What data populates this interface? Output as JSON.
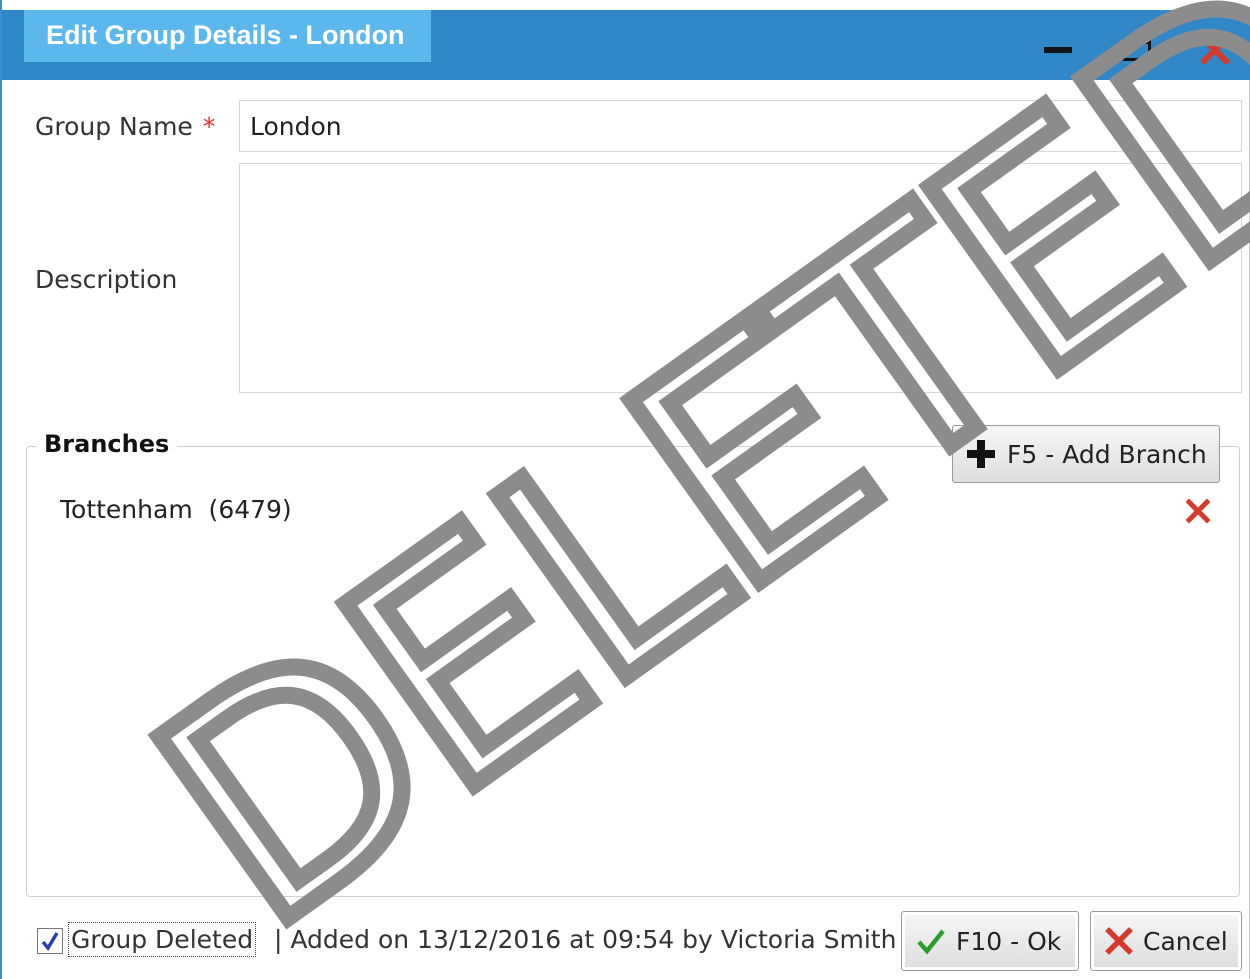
{
  "window": {
    "title": "Edit Group Details - London"
  },
  "form": {
    "group_name_label": "Group Name",
    "required_marker": "*",
    "group_name_value": "London",
    "description_label": "Description",
    "description_value": ""
  },
  "branches": {
    "legend": "Branches",
    "add_button_label": "F5 - Add Branch",
    "items": [
      {
        "label": "Tottenham  (6479)"
      }
    ]
  },
  "watermark": {
    "text": "DELETED"
  },
  "footer": {
    "deleted_checkbox_label": "Group Deleted",
    "deleted_checked": true,
    "status_text": "| Added on 13/12/2016 at 09:54 by Victoria Smith",
    "ok_label": "F10 - Ok",
    "cancel_label": "Cancel"
  },
  "colors": {
    "titlebar": "#2f87c8",
    "title_tab": "#5cb8ec",
    "close_red": "#d63a2a",
    "ok_green": "#2aa02a",
    "watermark_gray": "#8c8c8c"
  }
}
